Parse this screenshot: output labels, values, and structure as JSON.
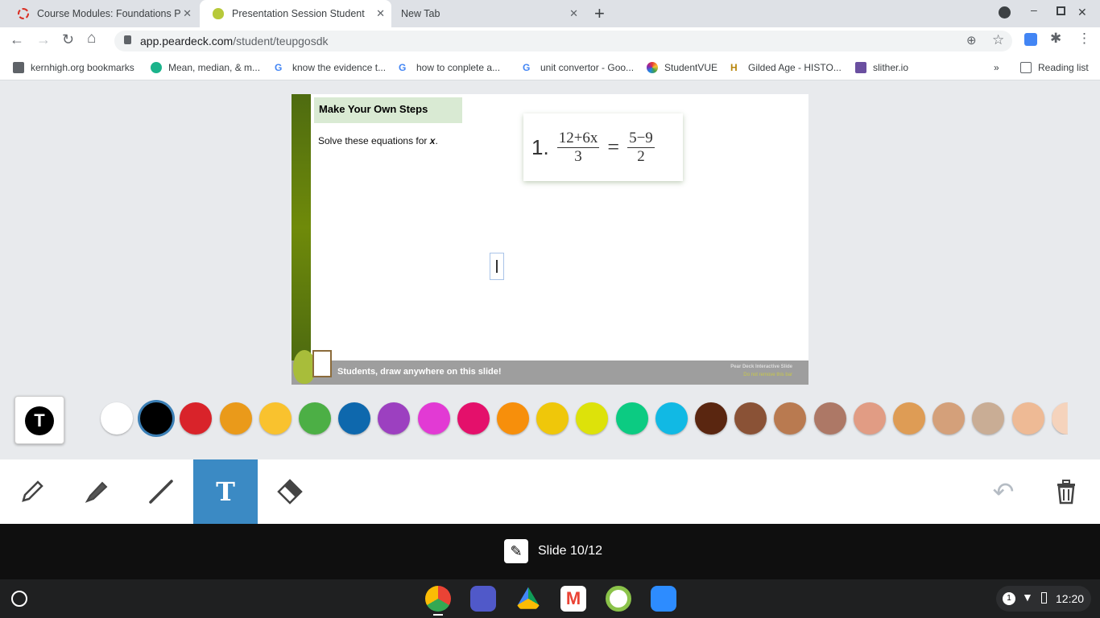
{
  "browser": {
    "tabs": [
      {
        "label": "Course Modules: Foundations P",
        "active": false
      },
      {
        "label": "Presentation Session Student",
        "active": true
      },
      {
        "label": "New Tab",
        "active": false
      }
    ],
    "url_domain": "app.peardeck.com",
    "url_path": "/student/teupgosdk",
    "bookmarks": [
      "kernhigh.org bookmarks",
      "Mean, median, & m...",
      "know the evidence t...",
      "how to conplete a...",
      "unit convertor - Goo...",
      "StudentVUE",
      "Gilded Age - HISTO...",
      "slither.io"
    ],
    "overflow": "»",
    "reading_list": "Reading list"
  },
  "slide": {
    "title": "Make Your Own Steps",
    "instruction": "Solve these equations for",
    "variable": "x",
    "period": ".",
    "equation": {
      "number": "1.",
      "lhs_num": "12+6x",
      "lhs_den": "3",
      "eq": "=",
      "rhs_num": "5−9",
      "rhs_den": "2"
    },
    "footer": "Students, draw anywhere on this slide!",
    "brand_line1": "Pear Deck Interactive Slide",
    "brand_line2": "Do not remove this bar"
  },
  "palette": {
    "selected": "#000000",
    "colors": [
      "#ffffff",
      "#000000",
      "#d9232a",
      "#ea9a1a",
      "#f9c22e",
      "#4caf45",
      "#0e68ad",
      "#9c40c0",
      "#e23ad4",
      "#e4106b",
      "#f78f0b",
      "#efc70a",
      "#dde20a",
      "#0ccb82",
      "#11b9e4",
      "#5a2610",
      "#8a5236",
      "#b97a50",
      "#ad7866",
      "#e19c84",
      "#de9c55",
      "#d4a07a",
      "#c9ad95",
      "#eeba95",
      "#f5d3bc"
    ]
  },
  "tools": {
    "items": [
      "pencil",
      "marker",
      "line",
      "text",
      "eraser"
    ],
    "active": "text"
  },
  "status": {
    "slide_label": "Slide 10/12"
  },
  "shelf": {
    "badge": "1",
    "time": "12:20"
  }
}
